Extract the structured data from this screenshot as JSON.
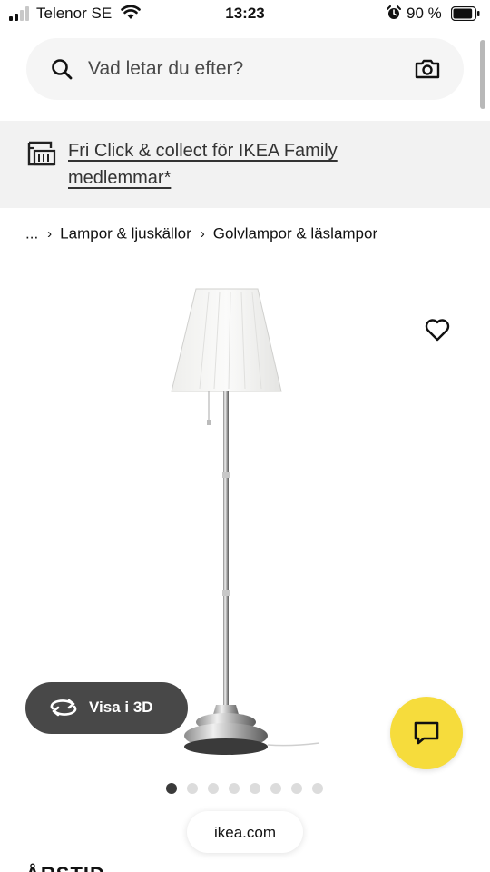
{
  "status_bar": {
    "carrier": "Telenor SE",
    "time": "13:23",
    "battery_percent": "90 %",
    "battery_level": 0.9,
    "icons": [
      "signal-icon",
      "wifi-icon",
      "alarm-icon",
      "battery-icon"
    ]
  },
  "search": {
    "placeholder": "Vad letar du efter?",
    "icons": [
      "search-icon",
      "camera-icon"
    ]
  },
  "banner": {
    "icon": "store-icon",
    "link_text": "Fri Click & collect för IKEA Family medlemmar*"
  },
  "breadcrumb": {
    "items": [
      "...",
      "Lampor & ljuskällor",
      "Golvlampor & läslampor"
    ]
  },
  "product": {
    "view_3d_label": "Visa i 3D",
    "image_icon": "floor-lamp",
    "name_partial": "ÅRSTID"
  },
  "gallery": {
    "total_images": 8,
    "active_index": 0
  },
  "browser": {
    "url": "ikea.com"
  },
  "colors": {
    "chat_button": "#f6dc3c",
    "view3d_button": "#484848",
    "banner_bg": "#f2f2f2",
    "search_bg": "#f5f5f5"
  }
}
